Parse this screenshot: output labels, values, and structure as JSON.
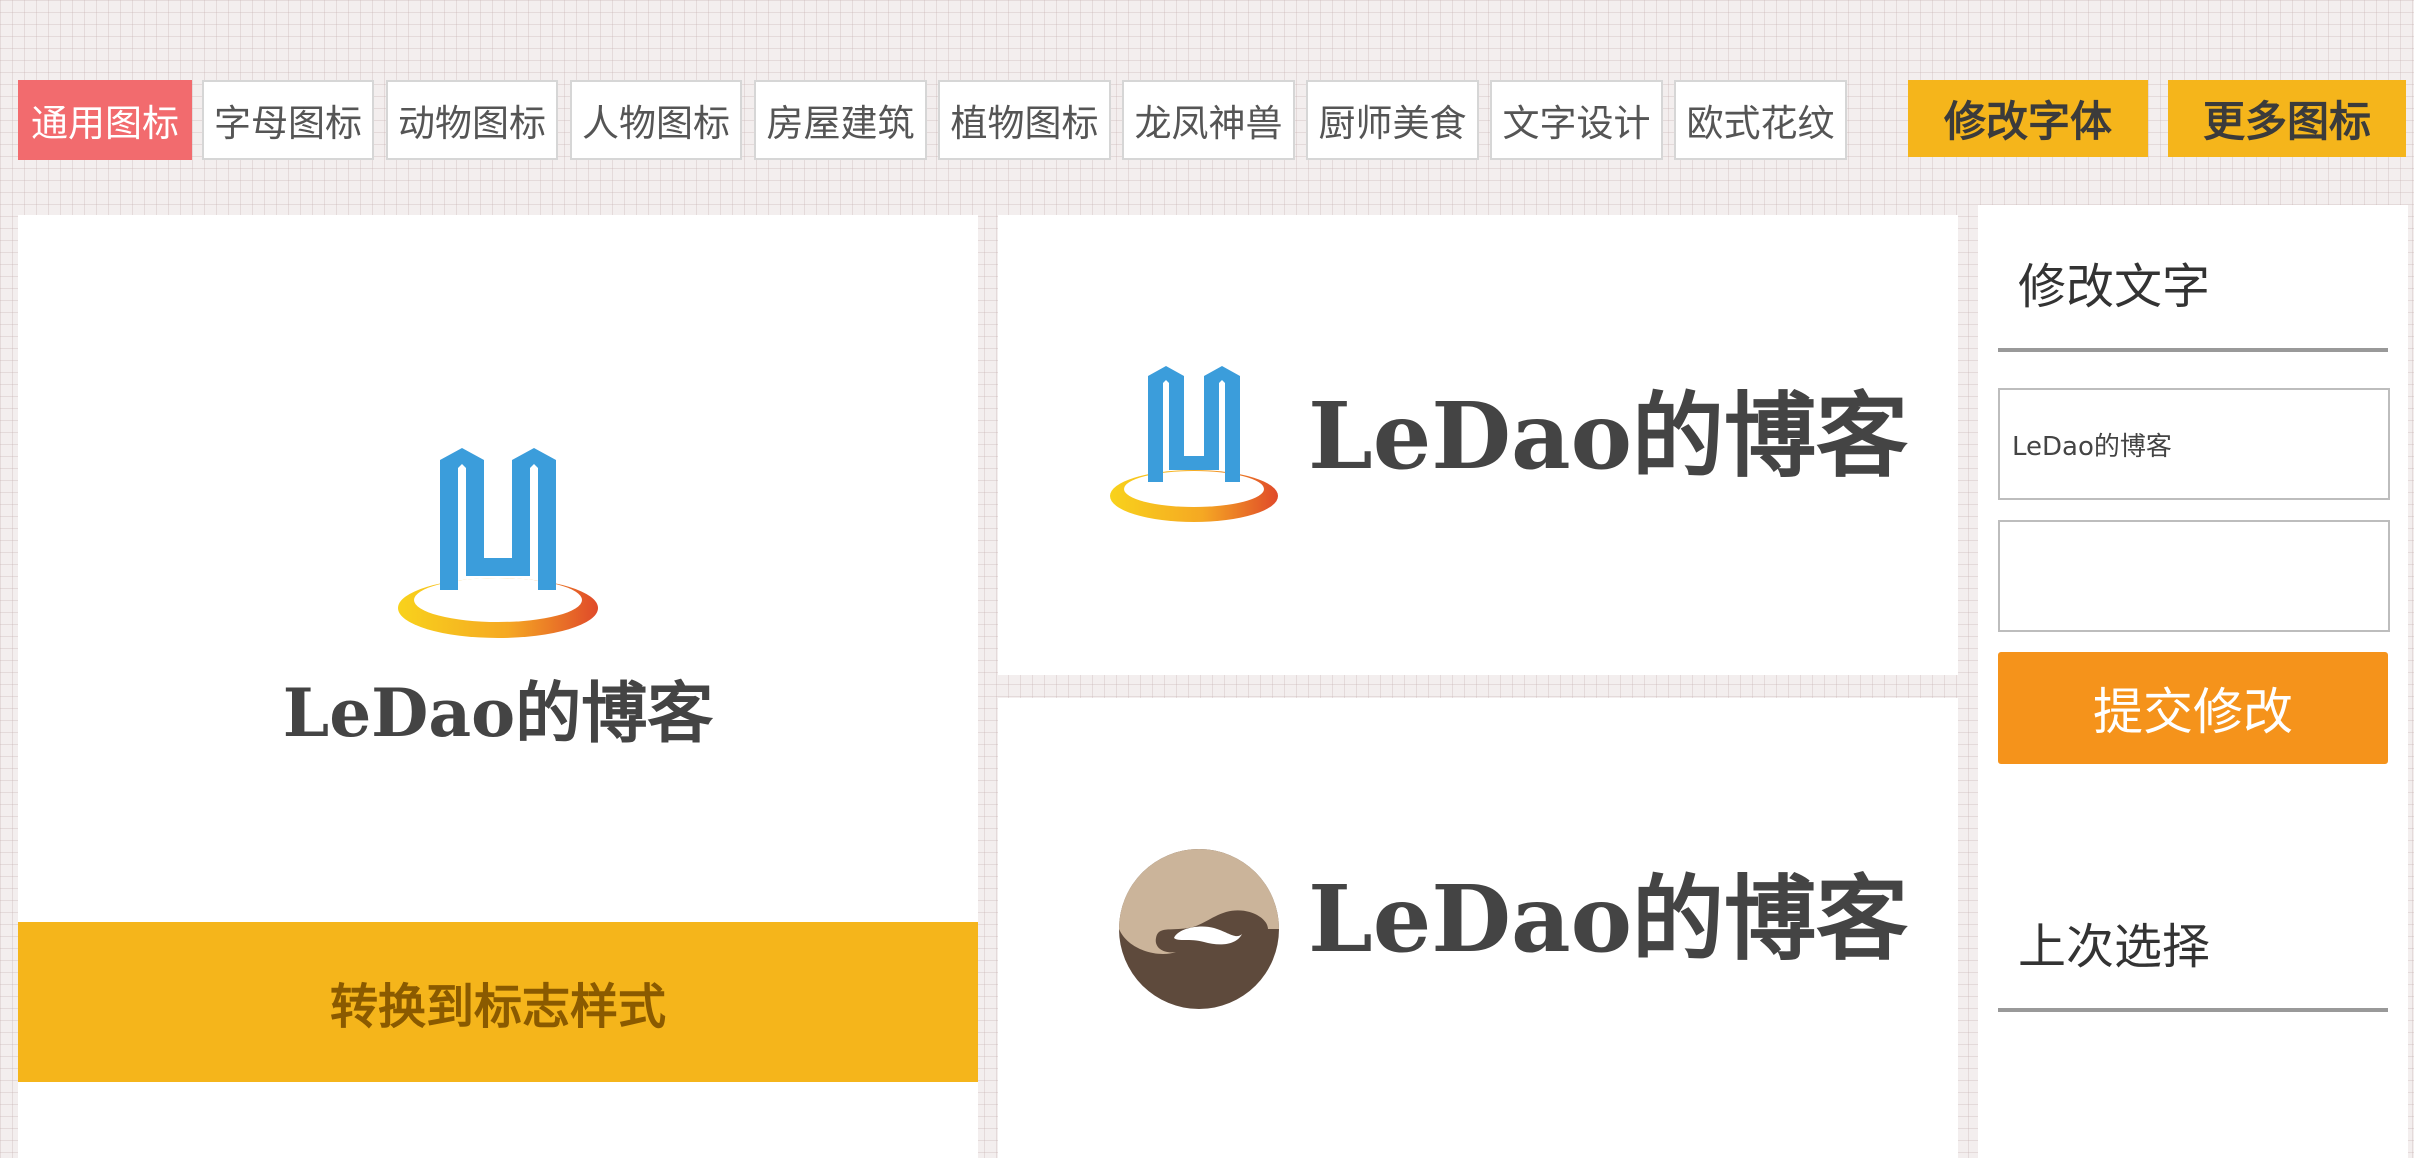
{
  "categories": {
    "tabs": [
      {
        "label": "通用图标",
        "active": true
      },
      {
        "label": "字母图标",
        "active": false
      },
      {
        "label": "动物图标",
        "active": false
      },
      {
        "label": "人物图标",
        "active": false
      },
      {
        "label": "房屋建筑",
        "active": false
      },
      {
        "label": "植物图标",
        "active": false
      },
      {
        "label": "龙凤神兽",
        "active": false
      },
      {
        "label": "厨师美食",
        "active": false
      },
      {
        "label": "文字设计",
        "active": false
      },
      {
        "label": "欧式花纹",
        "active": false
      }
    ],
    "modify_font_label": "修改字体",
    "more_icons_label": "更多图标"
  },
  "preview": {
    "stacked": {
      "icon": "building-ring-icon",
      "text": "LeDao的博客",
      "convert_label": "转换到标志样式"
    },
    "horizontal": [
      {
        "icon": "building-ring-icon",
        "text": "LeDao的博客"
      },
      {
        "icon": "yin-yang-swirl-icon",
        "text": "LeDao的博客"
      }
    ]
  },
  "sidebar": {
    "modify_text_heading": "修改文字",
    "text_field_value": "LeDao的博客",
    "second_field_value": "",
    "submit_label": "提交修改",
    "last_choice_heading": "上次选择"
  },
  "colors": {
    "active_tab": "#f26b6e",
    "accent_yellow": "#f5b51b",
    "submit_orange": "#f5931b",
    "logo_blue": "#3b9ddb",
    "logo_brown_dark": "#5e4a3c",
    "logo_brown_light": "#cbb49a"
  }
}
